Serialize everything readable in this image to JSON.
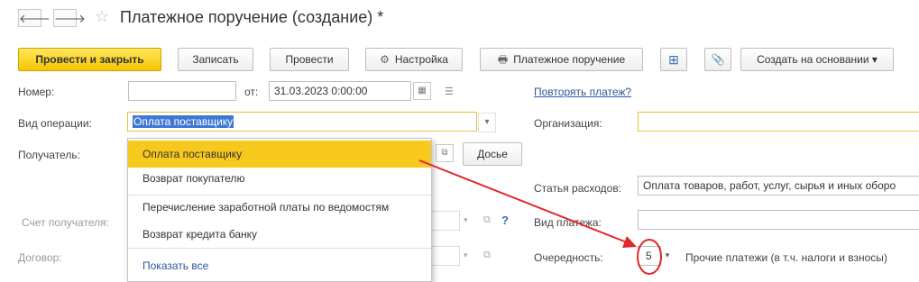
{
  "window": {
    "title": "Платежное поручение (создание) *",
    "back_glyph": "🡐",
    "forward_glyph": "🡒",
    "star_glyph": "☆"
  },
  "toolbar": {
    "post_close": "Провести и закрыть",
    "save": "Записать",
    "post": "Провести",
    "settings": "Настройка",
    "payment_order": "Платежное поручение",
    "create_based": "Создать на основании",
    "gear_glyph": "⚙",
    "printer_glyph": "🖶",
    "struct_glyph": "⊞",
    "clip_glyph": "📎",
    "caret_glyph": "▾"
  },
  "form": {
    "number_label": "Номер:",
    "number_value": "",
    "from_label": "от:",
    "date_value": "31.03.2023  0:00:00",
    "repeat_link": "Повторять платеж?",
    "operation_label": "Вид операции:",
    "operation_value": "Оплата поставщику",
    "organization_label": "Организация:",
    "organization_value": "",
    "recipient_label": "Получатель:",
    "dossier_button": "Досье",
    "expense_label": "Статья расходов:",
    "expense_value": "Оплата товаров, работ, услуг, сырья и иных оборо",
    "account_label": "Счет получателя:",
    "question_mark": "?",
    "payment_type_label": "Вид платежа:",
    "payment_type_value": "",
    "contract_label": "Договор:",
    "priority_label": "Очередность:",
    "priority_value": "5",
    "priority_desc": "Прочие платежи (в т.ч. налоги и взносы)"
  },
  "dropdown": {
    "items": [
      "Оплата поставщику",
      "Возврат покупателю",
      "Перечисление заработной платы по ведомостям",
      "Возврат кредита банку"
    ],
    "selected_index": 0,
    "show_all": "Показать все"
  },
  "annotation": {
    "color": "#e0282c"
  }
}
